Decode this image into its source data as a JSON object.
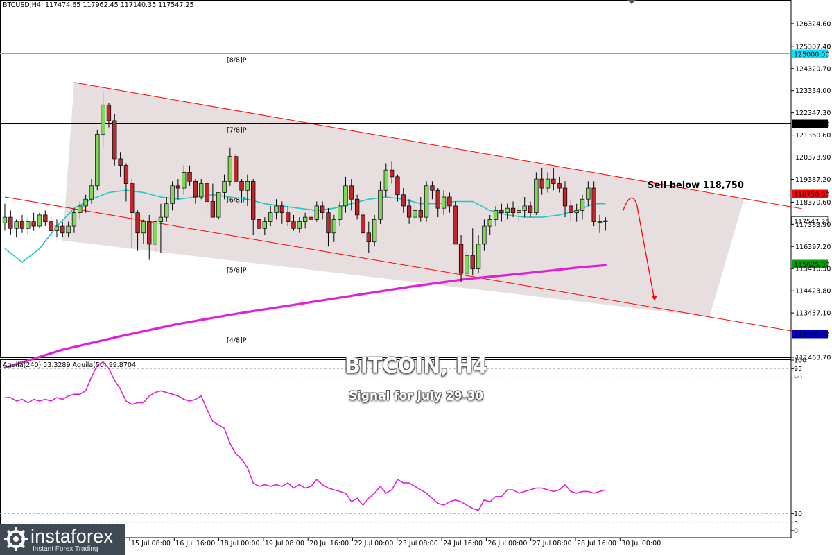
{
  "header": {
    "symbol": "BTCUSD,H4",
    "ohlc": "117474.65 117962.45 117140.35 117547.25"
  },
  "overlay": {
    "title": "BITCOIN, H4",
    "subtitle": "Signal for July 29-30"
  },
  "annotation": {
    "sell_text": "Sell below 118,750"
  },
  "brand": {
    "name": "instaforex",
    "tagline": "Instant Forex Trading"
  },
  "colors": {
    "bull": "#7ed957",
    "bear": "#c0262c",
    "channel": "#ff0000",
    "ma_short": "#1ec8c8",
    "ma_long": "#e020d8",
    "oscillator": "#e020d8",
    "murrey_8_8": "#00e5ff",
    "murrey_7_8": "#000000",
    "murrey_6_8": "#ff0000",
    "murrey_5_8": "#00a000",
    "murrey_4_8": "#0000c8"
  },
  "chart_data": [
    {
      "type": "candlestick",
      "symbol": "BTCUSD",
      "timeframe": "H4",
      "ylim": [
        111463.7,
        127310.5
      ],
      "y_ticks": [
        "126324.60",
        "125307.40",
        "124320.70",
        "123334.00",
        "122347.30",
        "121360.60",
        "120373.90",
        "119387.20",
        "118370.60",
        "117383.90",
        "116397.20",
        "115410.50",
        "114423.80",
        "113437.10",
        "111463.70"
      ],
      "x_ticks": [
        "15 Jul 08:00",
        "16 Jul 16:00",
        "18 Jul 00:00",
        "19 Jul 08:00",
        "20 Jul 16:00",
        "22 Jul 00:00",
        "23 Jul 08:00",
        "24 Jul 16:00",
        "26 Jul 00:00",
        "27 Jul 08:00",
        "28 Jul 16:00",
        "30 Jul 00:00"
      ],
      "levels": [
        {
          "label": "[8/8]P",
          "value": 125000.0,
          "tag": "125000.00",
          "color_key": "murrey_8_8"
        },
        {
          "label": "[7/8]P",
          "value": 121875.0,
          "tag": "121875.00",
          "color_key": "murrey_7_8"
        },
        {
          "label": "[6/8]P",
          "value": 118750.0,
          "tag": "118750.00",
          "color_key": "murrey_6_8"
        },
        {
          "label": "[5/8]P",
          "value": 115625.0,
          "tag": "115625.00",
          "color_key": "murrey_5_8"
        },
        {
          "label": "[4/8]P",
          "value": 112500.0,
          "tag": "112500.00",
          "color_key": "murrey_4_8"
        }
      ],
      "current_price": {
        "value": 117547.25,
        "tag": "117547.25"
      },
      "candles": [
        [
          117450,
          118300,
          117100,
          117700
        ],
        [
          117700,
          118000,
          116900,
          117200
        ],
        [
          117200,
          117600,
          116800,
          117500
        ],
        [
          117500,
          117800,
          117000,
          117200
        ],
        [
          117200,
          117700,
          116900,
          117500
        ],
        [
          117500,
          117900,
          117100,
          117300
        ],
        [
          117300,
          117900,
          117200,
          117800
        ],
        [
          117800,
          118000,
          117300,
          117500
        ],
        [
          117500,
          117700,
          116900,
          117100
        ],
        [
          117100,
          117600,
          116800,
          117300
        ],
        [
          117300,
          117500,
          116800,
          117000
        ],
        [
          117000,
          117500,
          116800,
          117300
        ],
        [
          117300,
          118100,
          117000,
          117900
        ],
        [
          117900,
          118400,
          117600,
          118200
        ],
        [
          118200,
          118700,
          117900,
          118500
        ],
        [
          118500,
          119400,
          118300,
          119100
        ],
        [
          119100,
          121600,
          118900,
          121400
        ],
        [
          121400,
          123300,
          120800,
          122700
        ],
        [
          122700,
          122800,
          121700,
          122000
        ],
        [
          122000,
          122300,
          120000,
          120300
        ],
        [
          120300,
          120600,
          119500,
          120000
        ],
        [
          120000,
          120100,
          118400,
          119200
        ],
        [
          119200,
          119400,
          116300,
          117900
        ],
        [
          117900,
          118000,
          116200,
          117000
        ],
        [
          117000,
          117600,
          116500,
          117500
        ],
        [
          117500,
          117800,
          115800,
          116500
        ],
        [
          116500,
          117700,
          116100,
          117500
        ],
        [
          117500,
          118300,
          116100,
          117700
        ],
        [
          117700,
          118600,
          117500,
          118300
        ],
        [
          118300,
          119300,
          118000,
          119100
        ],
        [
          119100,
          119400,
          118500,
          119000
        ],
        [
          119000,
          120000,
          118700,
          119700
        ],
        [
          119700,
          120000,
          119100,
          119300
        ],
        [
          119300,
          119400,
          118300,
          118600
        ],
        [
          118600,
          119400,
          118500,
          119200
        ],
        [
          119200,
          119300,
          118100,
          118400
        ],
        [
          118400,
          119200,
          117900,
          117700
        ],
        [
          117700,
          118800,
          117600,
          118800
        ],
        [
          118800,
          119600,
          118500,
          119300
        ],
        [
          119300,
          120800,
          119100,
          120400
        ],
        [
          120400,
          120500,
          119300,
          119300
        ],
        [
          119300,
          119400,
          118600,
          118900
        ],
        [
          118900,
          119600,
          118200,
          119300
        ],
        [
          119300,
          119400,
          116900,
          117600
        ],
        [
          117600,
          118100,
          116800,
          117200
        ],
        [
          117200,
          117700,
          116900,
          117500
        ],
        [
          117500,
          118200,
          117300,
          117900
        ],
        [
          117900,
          118500,
          117600,
          118200
        ],
        [
          118200,
          118400,
          117400,
          117900
        ],
        [
          117900,
          118200,
          117300,
          117500
        ],
        [
          117500,
          117800,
          117100,
          117200
        ],
        [
          117200,
          117700,
          117000,
          117500
        ],
        [
          117500,
          117900,
          117200,
          117700
        ],
        [
          117700,
          118200,
          117400,
          117600
        ],
        [
          117600,
          118400,
          117500,
          118200
        ],
        [
          118200,
          118400,
          117600,
          117900
        ],
        [
          117900,
          118100,
          116400,
          117000
        ],
        [
          117000,
          117800,
          116600,
          117600
        ],
        [
          117600,
          118400,
          117300,
          118200
        ],
        [
          118200,
          119500,
          117900,
          119100
        ],
        [
          119100,
          119400,
          118000,
          118500
        ],
        [
          118500,
          118700,
          117600,
          117800
        ],
        [
          117800,
          118100,
          116800,
          117000
        ],
        [
          117000,
          117500,
          116100,
          116600
        ],
        [
          116600,
          117800,
          116400,
          117600
        ],
        [
          117600,
          119300,
          117400,
          118900
        ],
        [
          118900,
          120100,
          118600,
          119800
        ],
        [
          119800,
          120200,
          119200,
          119500
        ],
        [
          119500,
          119600,
          118400,
          118700
        ],
        [
          118700,
          119000,
          117900,
          118200
        ],
        [
          118200,
          118500,
          117400,
          117700
        ],
        [
          117700,
          118300,
          117300,
          118000
        ],
        [
          118000,
          118600,
          117500,
          117700
        ],
        [
          117700,
          119300,
          117500,
          119100
        ],
        [
          119100,
          119300,
          118500,
          118900
        ],
        [
          118900,
          119000,
          117700,
          118100
        ],
        [
          118100,
          118900,
          117800,
          118600
        ],
        [
          118600,
          118800,
          117900,
          118200
        ],
        [
          118200,
          118400,
          116800,
          116500
        ],
        [
          116500,
          116900,
          114800,
          115200
        ],
        [
          115200,
          116200,
          114900,
          116000
        ],
        [
          116000,
          117200,
          115100,
          115400
        ],
        [
          115400,
          116900,
          115200,
          116500
        ],
        [
          116500,
          117600,
          116200,
          117300
        ],
        [
          117300,
          117800,
          116900,
          117600
        ],
        [
          117600,
          118200,
          117300,
          118000
        ],
        [
          118000,
          118300,
          117500,
          117900
        ],
        [
          117900,
          118300,
          117600,
          118100
        ],
        [
          118100,
          118400,
          117700,
          117900
        ],
        [
          117900,
          118200,
          117500,
          118000
        ],
        [
          118000,
          118600,
          117700,
          118200
        ],
        [
          118200,
          118400,
          117700,
          117900
        ],
        [
          117900,
          119700,
          117800,
          119400
        ],
        [
          119400,
          119900,
          118700,
          119000
        ],
        [
          119000,
          119700,
          118800,
          119400
        ],
        [
          119400,
          119900,
          118900,
          119200
        ],
        [
          119200,
          119500,
          118800,
          119000
        ],
        [
          119000,
          119300,
          117700,
          118200
        ],
        [
          118200,
          118500,
          117500,
          117900
        ],
        [
          117900,
          118300,
          117500,
          118000
        ],
        [
          118000,
          118700,
          117600,
          118500
        ],
        [
          118500,
          119300,
          118200,
          119000
        ],
        [
          119000,
          119300,
          117300,
          117500
        ],
        [
          117500,
          117800,
          117000,
          117500
        ],
        [
          117500,
          117700,
          117100,
          117547.25
        ]
      ],
      "ma_short": [
        [
          0,
          116300
        ],
        [
          3,
          115700
        ],
        [
          6,
          116300
        ],
        [
          9,
          117300
        ],
        [
          12,
          118100
        ],
        [
          15,
          118500
        ],
        [
          18,
          118800
        ],
        [
          21,
          118900
        ],
        [
          24,
          118800
        ],
        [
          27,
          118600
        ],
        [
          30,
          118500
        ],
        [
          33,
          118600
        ],
        [
          36,
          118700
        ],
        [
          39,
          118600
        ],
        [
          42,
          118500
        ],
        [
          45,
          118300
        ],
        [
          48,
          118200
        ],
        [
          51,
          118100
        ],
        [
          54,
          118000
        ],
        [
          57,
          118100
        ],
        [
          60,
          118300
        ],
        [
          63,
          118500
        ],
        [
          66,
          118600
        ],
        [
          69,
          118500
        ],
        [
          72,
          118300
        ],
        [
          75,
          118300
        ],
        [
          78,
          118400
        ],
        [
          81,
          118400
        ],
        [
          84,
          118000
        ],
        [
          87,
          117800
        ],
        [
          90,
          117700
        ],
        [
          93,
          117700
        ],
        [
          96,
          117800
        ],
        [
          99,
          118000
        ],
        [
          102,
          118300
        ],
        [
          104,
          118300
        ]
      ],
      "ma_long": [
        [
          0,
          111000
        ],
        [
          10,
          111800
        ],
        [
          20,
          112400
        ],
        [
          30,
          112950
        ],
        [
          40,
          113400
        ],
        [
          50,
          113800
        ],
        [
          60,
          114200
        ],
        [
          70,
          114600
        ],
        [
          80,
          114950
        ],
        [
          90,
          115200
        ],
        [
          100,
          115480
        ],
        [
          104,
          115560
        ]
      ],
      "channel": {
        "upper": [
          [
            12,
            123700
          ],
          [
            138,
            118080
          ]
        ],
        "lower": [
          [
            0,
            118600
          ],
          [
            138,
            112560
          ]
        ]
      },
      "arrow": {
        "from": [
          108,
          118550
        ],
        "to": [
          112,
          114000
        ]
      }
    },
    {
      "type": "line",
      "legend": "Aguila(240) 53.3289  Aguila(50) 99.8704",
      "ylim": [
        0,
        100
      ],
      "y_ticks": [
        "100",
        "95",
        "90",
        "10",
        "5",
        "0"
      ],
      "dashed_levels": [
        95,
        90,
        10,
        5
      ],
      "values": [
        78,
        78,
        76,
        77,
        75,
        77,
        76,
        77,
        76,
        78,
        77,
        79,
        80,
        80,
        82,
        90,
        97,
        99,
        95,
        88,
        83,
        76,
        74,
        75,
        75,
        79,
        81,
        82,
        81,
        80,
        79,
        77,
        76,
        77,
        79,
        71,
        64,
        62,
        60,
        51,
        45,
        42,
        37,
        28,
        26,
        27,
        26,
        27,
        26,
        28,
        25,
        27,
        25,
        26,
        30,
        27,
        25,
        24,
        23,
        22,
        17,
        19,
        15,
        19,
        22,
        26,
        22,
        24,
        30,
        28,
        28,
        26,
        24,
        22,
        19,
        16,
        15,
        17,
        18,
        17,
        15,
        13,
        12,
        18,
        17,
        20,
        20,
        24,
        24,
        22,
        23,
        24,
        25,
        25,
        24,
        23,
        24,
        27,
        23,
        22,
        23,
        23,
        22,
        23,
        24
      ]
    }
  ]
}
